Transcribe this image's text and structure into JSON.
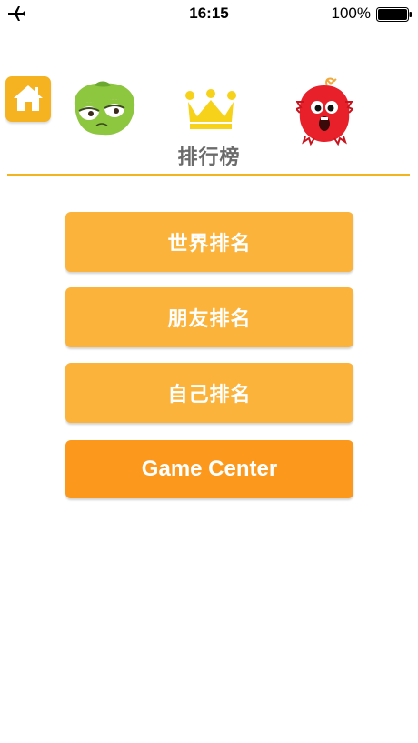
{
  "status_bar": {
    "time": "16:15",
    "battery_text": "100%"
  },
  "header": {
    "title": "排行榜",
    "home_icon": "home-icon",
    "crown_icon": "crown-icon"
  },
  "menu": {
    "items": [
      {
        "label": "世界排名"
      },
      {
        "label": "朋友排名"
      },
      {
        "label": "自己排名"
      },
      {
        "label": "Game Center"
      }
    ]
  },
  "colors": {
    "accent": "#f2b51f",
    "button": "#fbb33b",
    "button_primary": "#fc981b",
    "title_text": "#6b6b6b"
  }
}
